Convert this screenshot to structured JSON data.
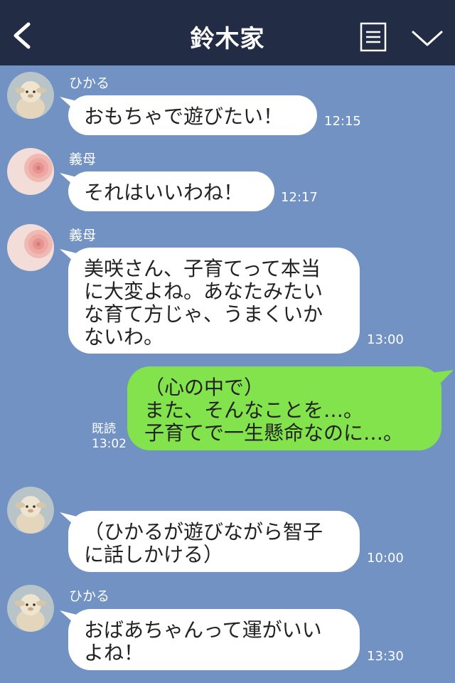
{
  "header": {
    "title": "鈴木家"
  },
  "messages": [
    {
      "sender": "ひかる",
      "text": "おもちゃで遊びたい！",
      "time": "12:15",
      "avatar": "sheep-plush"
    },
    {
      "sender": "義母",
      "text": "それはいいわね！",
      "time": "12:17",
      "avatar": "pink-flower"
    },
    {
      "sender": "義母",
      "text": "美咲さん、子育てって本当\nに大変よね。あなたみたい\nな育て方じゃ、うまくいか\nないわ。",
      "time": "13:00",
      "avatar": "pink-flower"
    },
    {
      "sender": "",
      "text": "（心の中で）\nまた、そんなことを…。\n子育てで一生懸命なのに…。",
      "read_label": "既読",
      "time": "13:02",
      "own": true
    },
    {
      "sender": "",
      "text": "（ひかるが遊びながら智子\nに話しかける）",
      "time": "10:00",
      "avatar": "sheep-plush"
    },
    {
      "sender": "ひかる",
      "text": "おばあちゃんって運がいい\nよね！",
      "time": "13:30",
      "avatar": "sheep-plush"
    }
  ],
  "colors": {
    "background": "#7192c3",
    "header": "#232c45",
    "own_bubble": "#82e34c",
    "other_bubble": "#ffffff"
  }
}
